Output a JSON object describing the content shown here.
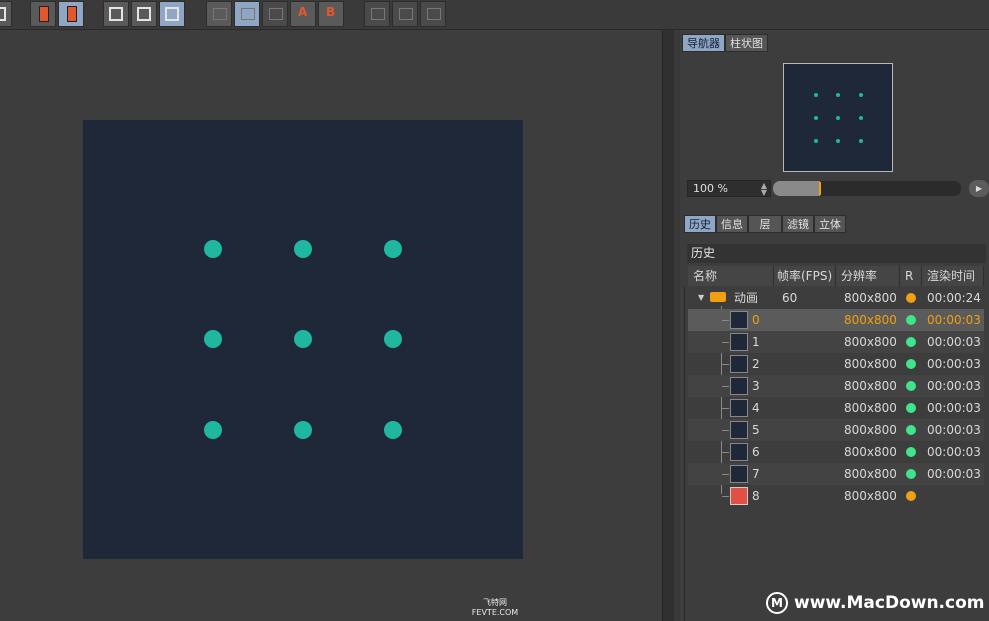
{
  "toolbar": {
    "buttons": [
      {
        "icon": "render-view-icon",
        "state": "normal"
      },
      {
        "icon": "delete-render-icon",
        "state": "normal"
      },
      {
        "icon": "delete-all-renders-icon",
        "state": "active"
      },
      {
        "icon": "render-region-icon",
        "state": "normal"
      },
      {
        "icon": "render-active-view-icon",
        "state": "normal"
      },
      {
        "icon": "render-selected-icon",
        "state": "active"
      },
      {
        "icon": "ab-compare-icon",
        "state": "normal"
      },
      {
        "icon": "ab-split-icon",
        "state": "active"
      },
      {
        "icon": "ab-swap-icon",
        "state": "disabled"
      },
      {
        "icon": "set-a-icon",
        "state": "normal",
        "text": "A"
      },
      {
        "icon": "set-b-icon",
        "state": "normal",
        "text": "B"
      },
      {
        "icon": "compare-left-icon",
        "state": "disabled"
      },
      {
        "icon": "compare-mid-icon",
        "state": "disabled"
      },
      {
        "icon": "compare-right-icon",
        "state": "disabled"
      }
    ]
  },
  "canvas": {
    "background": "#1e2839",
    "dot_color": "#1fb7a0"
  },
  "watermark_small": {
    "line1": "飞特网",
    "line2": "FEVTE.COM"
  },
  "navigator": {
    "tabs": [
      {
        "label": "导航器",
        "active": true
      },
      {
        "label": "柱状图",
        "active": false
      }
    ],
    "zoom": "100 %",
    "zoom_slider_percent": 25
  },
  "history_panel": {
    "tabs": [
      {
        "label": "历史",
        "active": true
      },
      {
        "label": "信息",
        "active": false
      },
      {
        "label": "层",
        "active": false
      },
      {
        "label": "滤镜",
        "active": false
      },
      {
        "label": "立体",
        "active": false
      }
    ],
    "title": "历史",
    "columns": [
      "名称",
      "帧率(FPS)",
      "分辨率",
      "R",
      "渲染时间"
    ],
    "folder": {
      "name": "动画",
      "fps": "60",
      "resolution": "800x800",
      "status": "orange",
      "time": "00:00:24"
    },
    "items": [
      {
        "name": "0",
        "resolution": "800x800",
        "status": "green",
        "time": "00:00:03",
        "selected": true
      },
      {
        "name": "1",
        "resolution": "800x800",
        "status": "green",
        "time": "00:00:03"
      },
      {
        "name": "2",
        "resolution": "800x800",
        "status": "green",
        "time": "00:00:03"
      },
      {
        "name": "3",
        "resolution": "800x800",
        "status": "green",
        "time": "00:00:03"
      },
      {
        "name": "4",
        "resolution": "800x800",
        "status": "green",
        "time": "00:00:03"
      },
      {
        "name": "5",
        "resolution": "800x800",
        "status": "green",
        "time": "00:00:03"
      },
      {
        "name": "6",
        "resolution": "800x800",
        "status": "green",
        "time": "00:00:03"
      },
      {
        "name": "7",
        "resolution": "800x800",
        "status": "green",
        "time": "00:00:03"
      },
      {
        "name": "8",
        "resolution": "800x800",
        "status": "orange",
        "time": ""
      }
    ],
    "colors": {
      "green": "#3ee58a",
      "orange": "#f0a010",
      "selected_text": "#f0a010"
    }
  },
  "watermark": {
    "text": "www.MacDown.com",
    "logo_letter": "M"
  }
}
